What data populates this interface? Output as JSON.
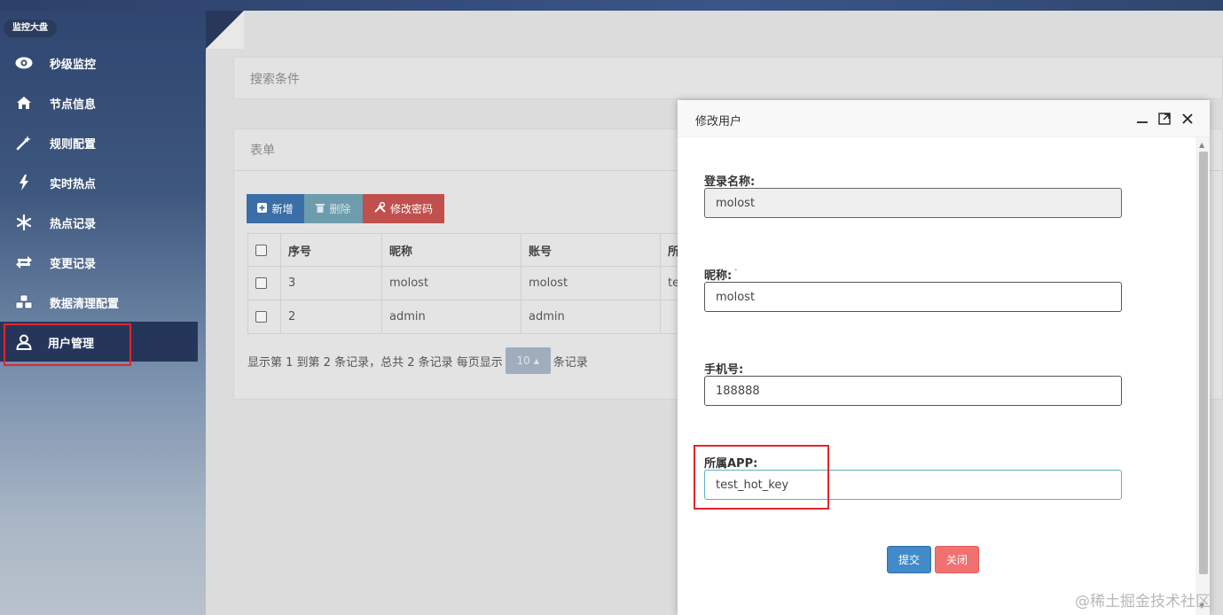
{
  "sidebar": {
    "brand": "监控大盘",
    "items": [
      {
        "label": "秒级监控",
        "icon": "eye-icon"
      },
      {
        "label": "节点信息",
        "icon": "home-icon"
      },
      {
        "label": "规则配置",
        "icon": "magic-wand-icon"
      },
      {
        "label": "实时热点",
        "icon": "bolt-icon"
      },
      {
        "label": "热点记录",
        "icon": "snowflake-icon"
      },
      {
        "label": "变更记录",
        "icon": "exchange-icon"
      },
      {
        "label": "数据清理配置",
        "icon": "cubes-icon"
      },
      {
        "label": "用户管理",
        "icon": "user-icon",
        "active": true
      }
    ]
  },
  "main": {
    "search_panel_title": "搜索条件",
    "form_panel_title": "表单",
    "toolbar": {
      "add_label": "新增",
      "delete_label": "删除",
      "change_password_label": "修改密码"
    },
    "table": {
      "headers": [
        "序号",
        "昵称",
        "账号",
        "所"
      ],
      "rows": [
        {
          "seq": "3",
          "nickname": "molost",
          "account": "molost",
          "app": "te"
        },
        {
          "seq": "2",
          "nickname": "admin",
          "account": "admin",
          "app": ""
        }
      ]
    },
    "pager": {
      "summary": "显示第 1 到第 2 条记录，总共 2 条记录 每页显示",
      "page_size": "10",
      "suffix": "条记录"
    }
  },
  "modal": {
    "title": "修改用户",
    "fields": {
      "login_name_label": "登录名称:",
      "login_name_value": "molost",
      "nickname_label": "昵称:",
      "nickname_required_mark": "·",
      "nickname_value": "molost",
      "phone_label": "手机号:",
      "phone_value": "188888",
      "app_label": "所属APP:",
      "app_value": "test_hot_key"
    },
    "submit_label": "提交",
    "close_label": "关闭"
  },
  "watermark": "@稀土掘金技术社区",
  "colors": {
    "sidebar_active": "#26365a",
    "primary": "#428bca",
    "danger": "#f07170",
    "highlight": "#e5242b"
  }
}
